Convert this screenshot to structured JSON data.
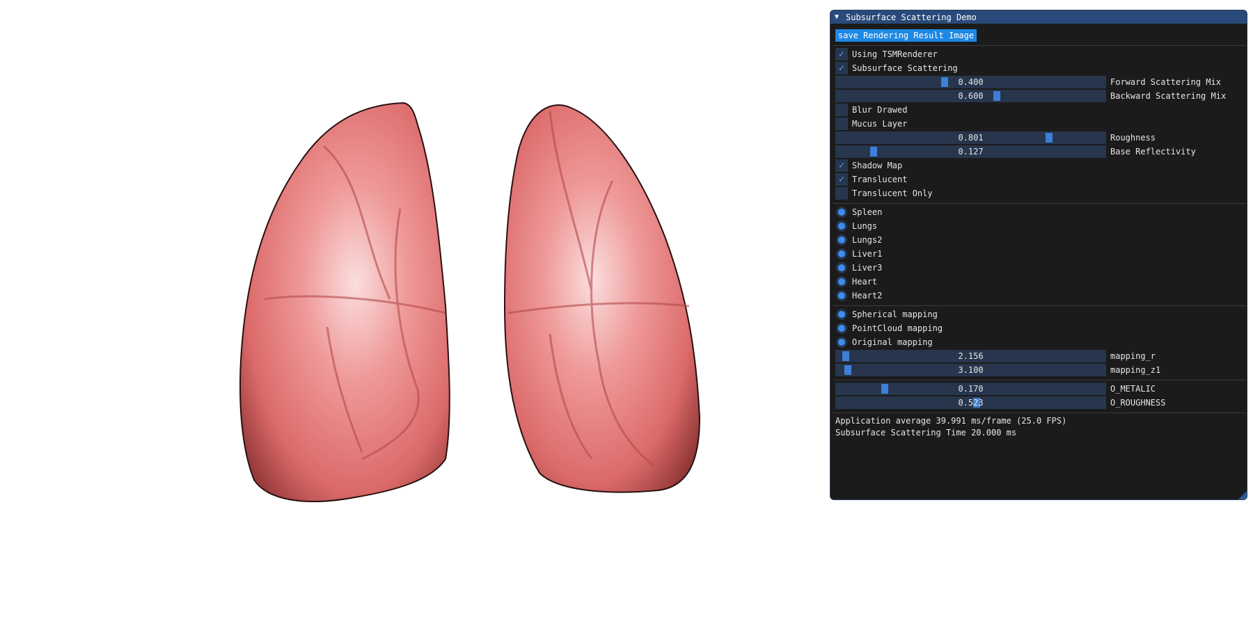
{
  "window": {
    "title": "Subsurface Scattering Demo",
    "collapse_icon": "triangle-down-icon"
  },
  "save_button": "save Rendering Result Image",
  "checkboxes_top": [
    {
      "label": "Using TSMRenderer",
      "checked": true
    },
    {
      "label": "Subsurface Scattering",
      "checked": true
    }
  ],
  "sliders_scatter": [
    {
      "value": "0.400",
      "fraction": 0.4,
      "label": "Forward Scattering Mix"
    },
    {
      "value": "0.600",
      "fraction": 0.6,
      "label": "Backward Scattering Mix"
    }
  ],
  "checkboxes_mid": [
    {
      "label": "Blur Drawed",
      "checked": false
    },
    {
      "label": "Mucus Layer",
      "checked": false
    }
  ],
  "sliders_surface": [
    {
      "value": "0.801",
      "fraction": 0.801,
      "label": "Roughness"
    },
    {
      "value": "0.127",
      "fraction": 0.127,
      "label": "Base Reflectivity"
    }
  ],
  "checkboxes_bottom": [
    {
      "label": "Shadow Map",
      "checked": true
    },
    {
      "label": "Translucent",
      "checked": true
    },
    {
      "label": "Translucent Only",
      "checked": false
    }
  ],
  "models": [
    "Spleen",
    "Lungs",
    "Lungs2",
    "Liver1",
    "Liver3",
    "Heart",
    "Heart2"
  ],
  "mappings": [
    "Spherical mapping",
    "PointCloud mapping",
    "Original mapping"
  ],
  "sliders_mapping": [
    {
      "value": "2.156",
      "fraction": 0.02,
      "label": "mapping_r"
    },
    {
      "value": "3.100",
      "fraction": 0.03,
      "label": "mapping_z1"
    }
  ],
  "sliders_material": [
    {
      "value": "0.170",
      "fraction": 0.17,
      "label": "O_METALIC"
    },
    {
      "value": "0.523",
      "fraction": 0.523,
      "label": "O_ROUGHNESS"
    }
  ],
  "stats": {
    "fps": "Application average 39.991 ms/frame (25.0 FPS)",
    "sss_time": "Subsurface Scattering Time 20.000 ms"
  },
  "colors": {
    "panel_bg": "#1b1b1c",
    "title_bg": "#294a7a",
    "accent": "#1e88e5",
    "frame_bg": "#27364d",
    "organ": "#e87070"
  }
}
